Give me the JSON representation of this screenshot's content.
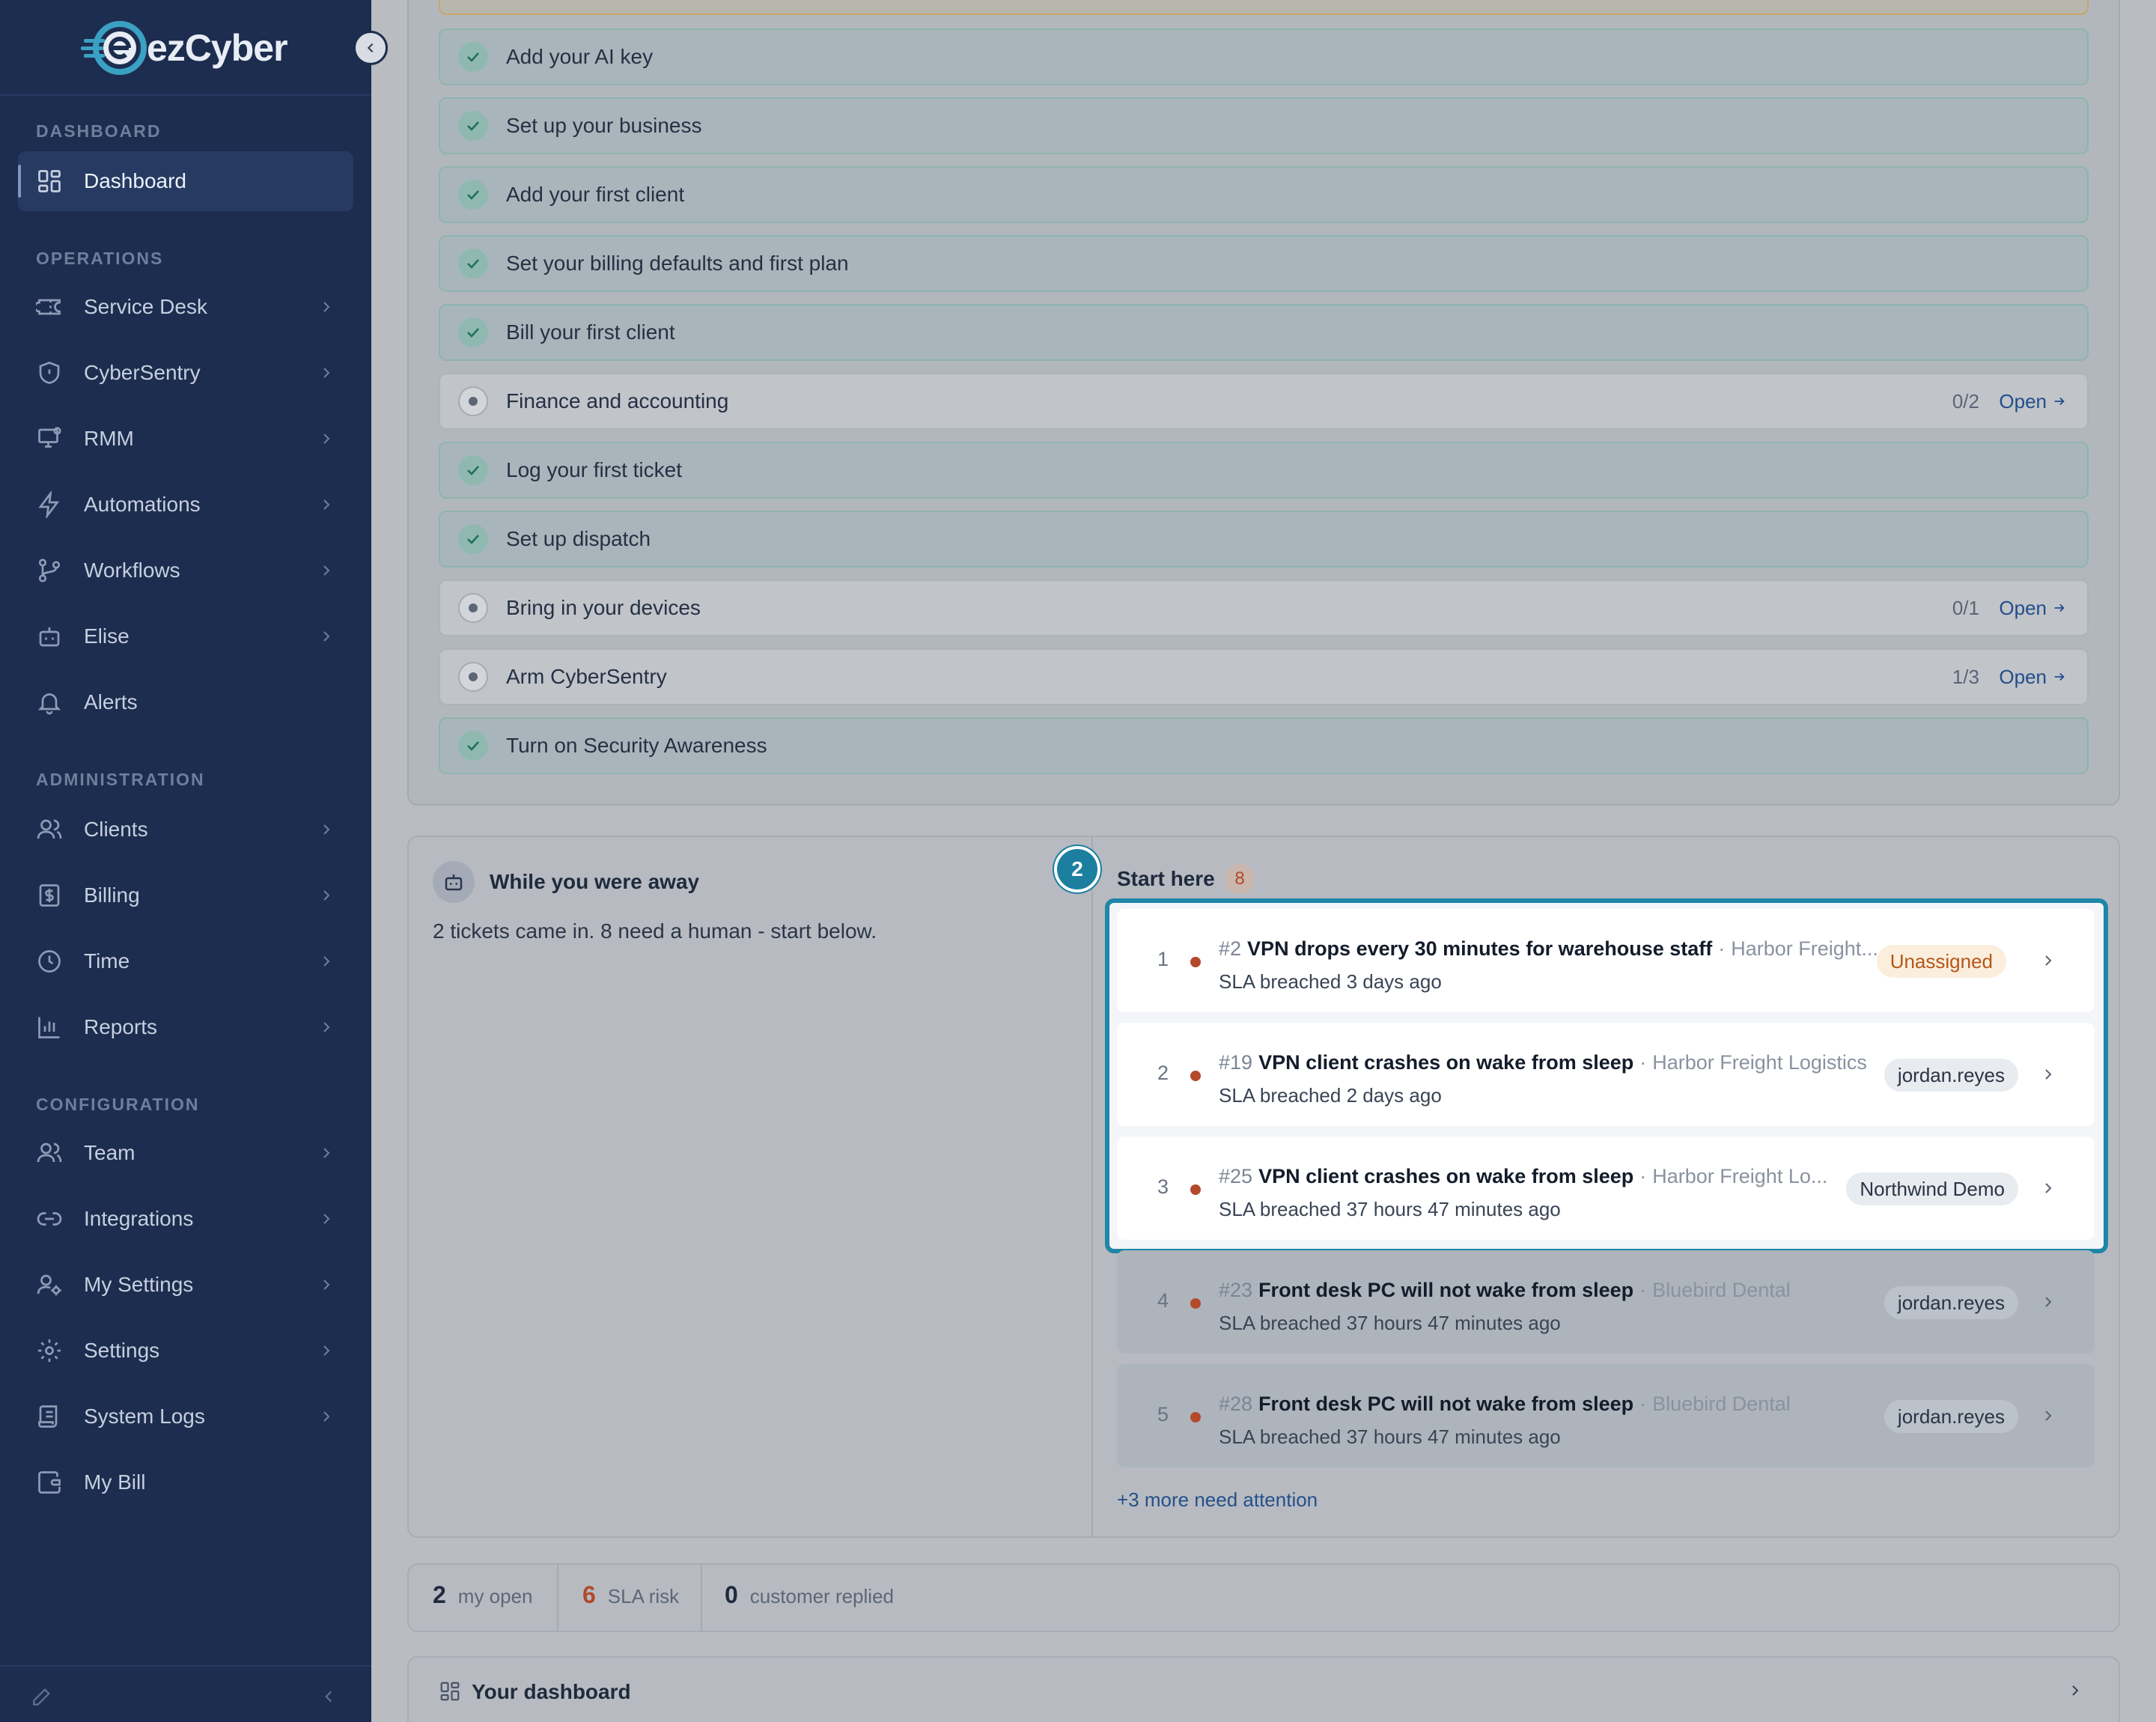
{
  "brand": {
    "name": "ezCyber"
  },
  "sidebar": {
    "sections": {
      "dashboard": "DASHBOARD",
      "operations": "OPERATIONS",
      "administration": "ADMINISTRATION",
      "configuration": "CONFIGURATION"
    },
    "items": [
      {
        "label": "Dashboard",
        "icon": "grid-icon"
      },
      {
        "label": "Service Desk",
        "icon": "ticket-icon"
      },
      {
        "label": "CyberSentry",
        "icon": "shield-icon"
      },
      {
        "label": "RMM",
        "icon": "monitor-icon"
      },
      {
        "label": "Automations",
        "icon": "bolt-icon"
      },
      {
        "label": "Workflows",
        "icon": "git-branch-icon"
      },
      {
        "label": "Elise",
        "icon": "bot-icon"
      },
      {
        "label": "Alerts",
        "icon": "bell-icon"
      },
      {
        "label": "Clients",
        "icon": "users-icon"
      },
      {
        "label": "Billing",
        "icon": "dollar-icon"
      },
      {
        "label": "Time",
        "icon": "clock-icon"
      },
      {
        "label": "Reports",
        "icon": "bar-chart-icon"
      },
      {
        "label": "Team",
        "icon": "team-icon"
      },
      {
        "label": "Integrations",
        "icon": "link-icon"
      },
      {
        "label": "My Settings",
        "icon": "user-cog-icon"
      },
      {
        "label": "Settings",
        "icon": "gear-icon"
      },
      {
        "label": "System Logs",
        "icon": "scroll-icon"
      },
      {
        "label": "My Bill",
        "icon": "wallet-icon"
      }
    ]
  },
  "checklist": [
    {
      "label": "Add your AI key",
      "done": true
    },
    {
      "label": "Set up your business",
      "done": true
    },
    {
      "label": "Add your first client",
      "done": true
    },
    {
      "label": "Set your billing defaults and first plan",
      "done": true
    },
    {
      "label": "Bill your first client",
      "done": true
    },
    {
      "label": "Finance and accounting",
      "done": false,
      "progress": "0/2",
      "action": "Open"
    },
    {
      "label": "Log your first ticket",
      "done": true
    },
    {
      "label": "Set up dispatch",
      "done": true
    },
    {
      "label": "Bring in your devices",
      "done": false,
      "progress": "0/1",
      "action": "Open"
    },
    {
      "label": "Arm CyberSentry",
      "done": false,
      "progress": "1/3",
      "action": "Open"
    },
    {
      "label": "Turn on Security Awareness",
      "done": true
    }
  ],
  "away": {
    "title": "While you were away",
    "summary": "2 tickets came in. 8 need a human - start below."
  },
  "start_here": {
    "step": "2",
    "title": "Start here",
    "count": "8",
    "tickets": [
      {
        "rank": "1",
        "id": "#2",
        "title": "VPN drops every 30 minutes for warehouse staff",
        "client": "Harbor Freight...",
        "sla": "SLA breached 3 days ago",
        "assignee": "Unassigned"
      },
      {
        "rank": "2",
        "id": "#19",
        "title": "VPN client crashes on wake from sleep",
        "client": "Harbor Freight Logistics",
        "sla": "SLA breached 2 days ago",
        "assignee": "jordan.reyes"
      },
      {
        "rank": "3",
        "id": "#25",
        "title": "VPN client crashes on wake from sleep",
        "client": "Harbor Freight Lo...",
        "sla": "SLA breached 37 hours 47 minutes ago",
        "assignee": "Northwind Demo"
      },
      {
        "rank": "4",
        "id": "#23",
        "title": "Front desk PC will not wake from sleep",
        "client": "Bluebird Dental",
        "sla": "SLA breached 37 hours 47 minutes ago",
        "assignee": "jordan.reyes"
      },
      {
        "rank": "5",
        "id": "#28",
        "title": "Front desk PC will not wake from sleep",
        "client": "Bluebird Dental",
        "sla": "SLA breached 37 hours 47 minutes ago",
        "assignee": "jordan.reyes"
      }
    ],
    "more": "+3 more need attention"
  },
  "stats": [
    {
      "value": "2",
      "label": "my open"
    },
    {
      "value": "6",
      "label": "SLA risk"
    },
    {
      "value": "0",
      "label": "customer replied"
    }
  ],
  "dashboard_card": {
    "title": "Your dashboard"
  },
  "colors": {
    "sidebar": "#1d2d4f",
    "accent": "#1e86a7",
    "danger": "#b4492c"
  }
}
